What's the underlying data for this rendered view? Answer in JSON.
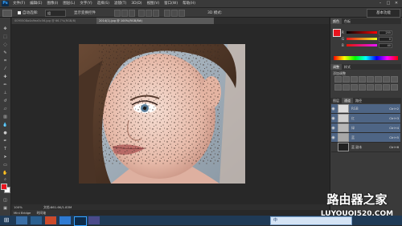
{
  "app": {
    "logo": "Ps",
    "menus": [
      "文件(F)",
      "编辑(E)",
      "图像(I)",
      "图层(L)",
      "文字(Y)",
      "选择(S)",
      "滤镜(T)",
      "3D(D)",
      "视图(V)",
      "窗口(W)",
      "帮助(H)"
    ],
    "window_controls": [
      "–",
      "□",
      "✕"
    ]
  },
  "options": {
    "auto_select": "自动选择:",
    "group": "组",
    "show_transform": "显示变换控件",
    "mode_3d": "3D 模式:",
    "workspace": "基本功能"
  },
  "tabs": [
    {
      "label": "0095508a4a9ea5c56.jpg @ 66.7%(RGB/8)"
    },
    {
      "label": "2014(1).jpg @ 100%(RGB/8#)"
    }
  ],
  "status": {
    "zoom": "100%",
    "doc": "文档:861.6K/1.83M",
    "mini_bridge": "Mini Bridge",
    "timeline": "时间轴"
  },
  "panels": {
    "color_tabs": [
      "颜色",
      "色板"
    ],
    "sliders": [
      {
        "label": "R",
        "value": "255",
        "color": "#e8141e"
      },
      {
        "label": "G",
        "value": "0",
        "color": "#4aa84a"
      },
      {
        "label": "B",
        "value": "40",
        "color": "#4a6ad8"
      }
    ],
    "adjust_tabs": [
      "调整",
      "样式"
    ],
    "adjust_title": "添加调整",
    "layers_tabs": [
      "图层",
      "通道",
      "路径"
    ],
    "layers": [
      {
        "name": "RGB",
        "shortcut": "Ctrl+2",
        "selected": true
      },
      {
        "name": "红",
        "shortcut": "Ctrl+3",
        "selected": true
      },
      {
        "name": "绿",
        "shortcut": "Ctrl+4",
        "selected": true
      },
      {
        "name": "蓝",
        "shortcut": "Ctrl+5",
        "selected": true
      },
      {
        "name": "蓝 副本",
        "shortcut": "Ctrl+6",
        "selected": false
      }
    ]
  },
  "watermark": {
    "title": "路由器之家",
    "url": "LUYOUQI520.COM"
  },
  "taskbar": {
    "tray_lang": "中"
  }
}
